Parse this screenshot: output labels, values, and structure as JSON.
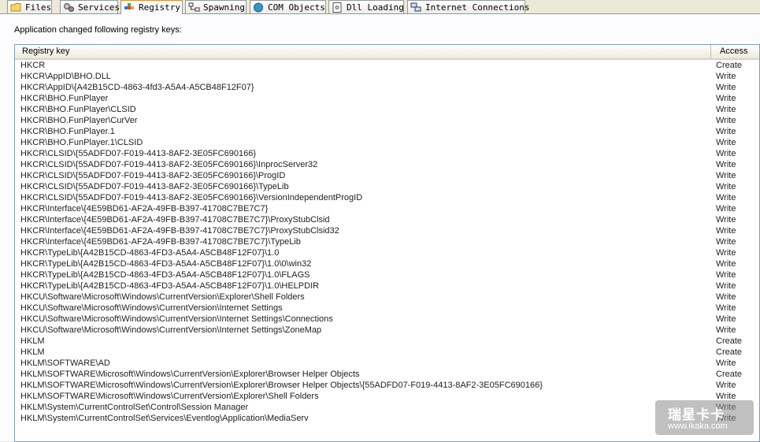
{
  "tabs": [
    {
      "label": "Files",
      "icon": "folder-icon",
      "active": false
    },
    {
      "label": "Services",
      "icon": "gears-icon",
      "active": false
    },
    {
      "label": "Registry",
      "icon": "registry-icon",
      "active": true
    },
    {
      "label": "Spawning",
      "icon": "process-tree-icon",
      "active": false
    },
    {
      "label": "COM Objects",
      "icon": "globe-icon",
      "active": false
    },
    {
      "label": "Dll Loading",
      "icon": "dll-icon",
      "active": false
    },
    {
      "label": "Internet Connections",
      "icon": "network-icon",
      "active": false
    }
  ],
  "panel": {
    "caption": "Application changed following registry keys:"
  },
  "table": {
    "columns": [
      "Registry key",
      "Access"
    ],
    "rows": [
      {
        "key": "HKCR",
        "access": "Create"
      },
      {
        "key": "HKCR\\AppID\\BHO.DLL",
        "access": "Write"
      },
      {
        "key": "HKCR\\AppID\\{A42B15CD-4863-4fd3-A5A4-A5CB48F12F07}",
        "access": "Write"
      },
      {
        "key": "HKCR\\BHO.FunPlayer",
        "access": "Write"
      },
      {
        "key": "HKCR\\BHO.FunPlayer\\CLSID",
        "access": "Write"
      },
      {
        "key": "HKCR\\BHO.FunPlayer\\CurVer",
        "access": "Write"
      },
      {
        "key": "HKCR\\BHO.FunPlayer.1",
        "access": "Write"
      },
      {
        "key": "HKCR\\BHO.FunPlayer.1\\CLSID",
        "access": "Write"
      },
      {
        "key": "HKCR\\CLSID\\{55ADFD07-F019-4413-8AF2-3E05FC690166}",
        "access": "Write"
      },
      {
        "key": "HKCR\\CLSID\\{55ADFD07-F019-4413-8AF2-3E05FC690166}\\InprocServer32",
        "access": "Write"
      },
      {
        "key": "HKCR\\CLSID\\{55ADFD07-F019-4413-8AF2-3E05FC690166}\\ProgID",
        "access": "Write"
      },
      {
        "key": "HKCR\\CLSID\\{55ADFD07-F019-4413-8AF2-3E05FC690166}\\TypeLib",
        "access": "Write"
      },
      {
        "key": "HKCR\\CLSID\\{55ADFD07-F019-4413-8AF2-3E05FC690166}\\VersionIndependentProgID",
        "access": "Write"
      },
      {
        "key": "HKCR\\Interface\\{4E59BD61-AF2A-49FB-B397-41708C7BE7C7}",
        "access": "Write"
      },
      {
        "key": "HKCR\\Interface\\{4E59BD61-AF2A-49FB-B397-41708C7BE7C7}\\ProxyStubClsid",
        "access": "Write"
      },
      {
        "key": "HKCR\\Interface\\{4E59BD61-AF2A-49FB-B397-41708C7BE7C7}\\ProxyStubClsid32",
        "access": "Write"
      },
      {
        "key": "HKCR\\Interface\\{4E59BD61-AF2A-49FB-B397-41708C7BE7C7}\\TypeLib",
        "access": "Write"
      },
      {
        "key": "HKCR\\TypeLib\\{A42B15CD-4863-4FD3-A5A4-A5CB48F12F07}\\1.0",
        "access": "Write"
      },
      {
        "key": "HKCR\\TypeLib\\{A42B15CD-4863-4FD3-A5A4-A5CB48F12F07}\\1.0\\0\\win32",
        "access": "Write"
      },
      {
        "key": "HKCR\\TypeLib\\{A42B15CD-4863-4FD3-A5A4-A5CB48F12F07}\\1.0\\FLAGS",
        "access": "Write"
      },
      {
        "key": "HKCR\\TypeLib\\{A42B15CD-4863-4FD3-A5A4-A5CB48F12F07}\\1.0\\HELPDIR",
        "access": "Write"
      },
      {
        "key": "HKCU\\Software\\Microsoft\\Windows\\CurrentVersion\\Explorer\\Shell Folders",
        "access": "Write"
      },
      {
        "key": "HKCU\\Software\\Microsoft\\Windows\\CurrentVersion\\Internet Settings",
        "access": "Write"
      },
      {
        "key": "HKCU\\Software\\Microsoft\\Windows\\CurrentVersion\\Internet Settings\\Connections",
        "access": "Write"
      },
      {
        "key": "HKCU\\Software\\Microsoft\\Windows\\CurrentVersion\\Internet Settings\\ZoneMap",
        "access": "Write"
      },
      {
        "key": "HKLM",
        "access": "Create"
      },
      {
        "key": "HKLM",
        "access": "Create"
      },
      {
        "key": "HKLM\\SOFTWARE\\AD",
        "access": "Write"
      },
      {
        "key": "HKLM\\SOFTWARE\\Microsoft\\Windows\\CurrentVersion\\Explorer\\Browser Helper Objects",
        "access": "Create"
      },
      {
        "key": "HKLM\\SOFTWARE\\Microsoft\\Windows\\CurrentVersion\\Explorer\\Browser Helper Objects\\{55ADFD07-F019-4413-8AF2-3E05FC690166}",
        "access": "Write"
      },
      {
        "key": "HKLM\\SOFTWARE\\Microsoft\\Windows\\CurrentVersion\\Explorer\\Shell Folders",
        "access": "Write"
      },
      {
        "key": "HKLM\\System\\CurrentControlSet\\Control\\Session Manager",
        "access": "Write"
      },
      {
        "key": "HKLM\\System\\CurrentControlSet\\Services\\Eventlog\\Application\\MediaServ",
        "access": "Write"
      }
    ]
  },
  "watermark": {
    "line1": "瑞星卡卡",
    "line2": "www.ikaka.com"
  },
  "colors": {
    "active_tab_accent": "#e68b2c",
    "list_border": "#7f9db9",
    "window_bg": "#ece9d8"
  }
}
